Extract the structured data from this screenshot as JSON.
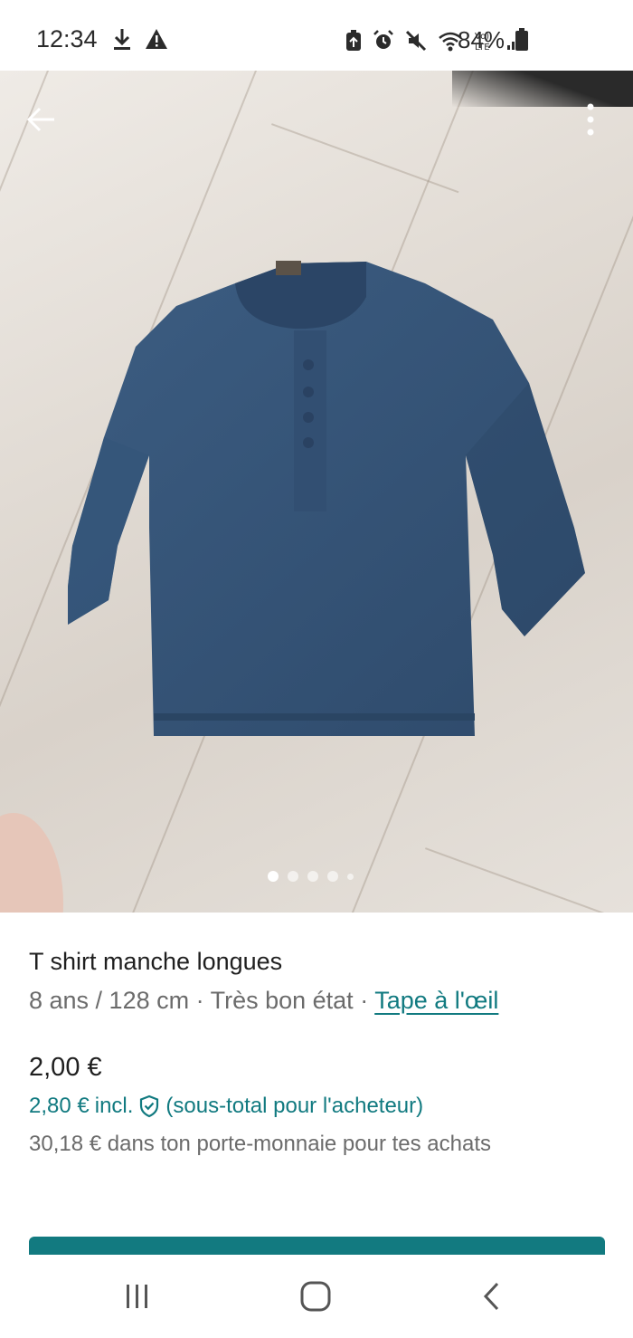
{
  "status_bar": {
    "time": "12:34",
    "battery": "84%",
    "icons": [
      "download-icon",
      "alert-icon",
      "battery-saver-icon",
      "alarm-icon",
      "mute-icon",
      "wifi-icon",
      "volte-icon",
      "signal-icon",
      "battery-icon"
    ]
  },
  "gallery": {
    "image_subject": "Navy blue long sleeve t-shirt on wooden floor",
    "pagination": {
      "count": 5,
      "active_index": 0
    }
  },
  "item": {
    "title": "T shirt manche longues",
    "meta_prefix": "8 ans / 128 cm · Très bon état · ",
    "brand": "Tape à l'œil",
    "price": "2,00 €",
    "price_incl_amount": "2,80 €",
    "price_incl_label": "incl.",
    "price_incl_note": "(sous-total pour l'acheteur)",
    "wallet_text": "30,18 € dans ton porte-monnaie pour tes achats"
  },
  "colors": {
    "accent": "#117a80",
    "text_primary": "#1f1f1f",
    "text_secondary": "#6b6b6b"
  }
}
